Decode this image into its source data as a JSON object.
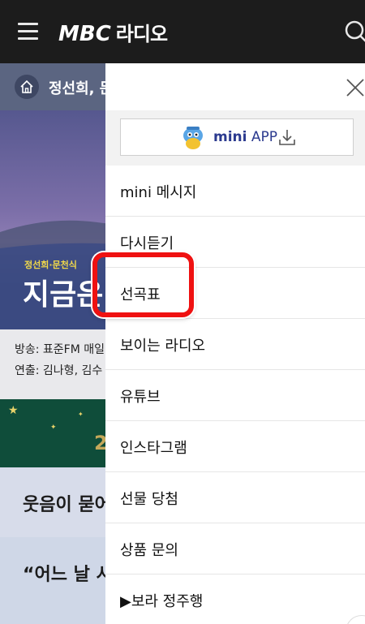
{
  "topbar": {
    "logo_brand": "MBC",
    "logo_section": "라디오"
  },
  "background": {
    "breadcrumb": "정선희, 문",
    "hero_small": "정선희·문천식",
    "hero_big": "지금은",
    "info_line1": "방송: 표준FM 매일",
    "info_line2": "연출: 김나형, 김수",
    "banner_text": "2",
    "card1_text": "웃음이 묻어",
    "card2_text": "“어느 날 시"
  },
  "drawer": {
    "mini_app_bold": "mini",
    "mini_app_rest": " APP",
    "menu": [
      {
        "label": "mini 메시지"
      },
      {
        "label": "다시듣기"
      },
      {
        "label": "선곡표"
      },
      {
        "label": "보이는 라디오"
      },
      {
        "label": "유튜브"
      },
      {
        "label": "인스타그램"
      },
      {
        "label": "선물 당첨"
      },
      {
        "label": "상품 문의"
      },
      {
        "label": "▶보라 정주행"
      }
    ]
  },
  "colors": {
    "highlight": "#ef1111",
    "brand": "#2b3a8f"
  }
}
